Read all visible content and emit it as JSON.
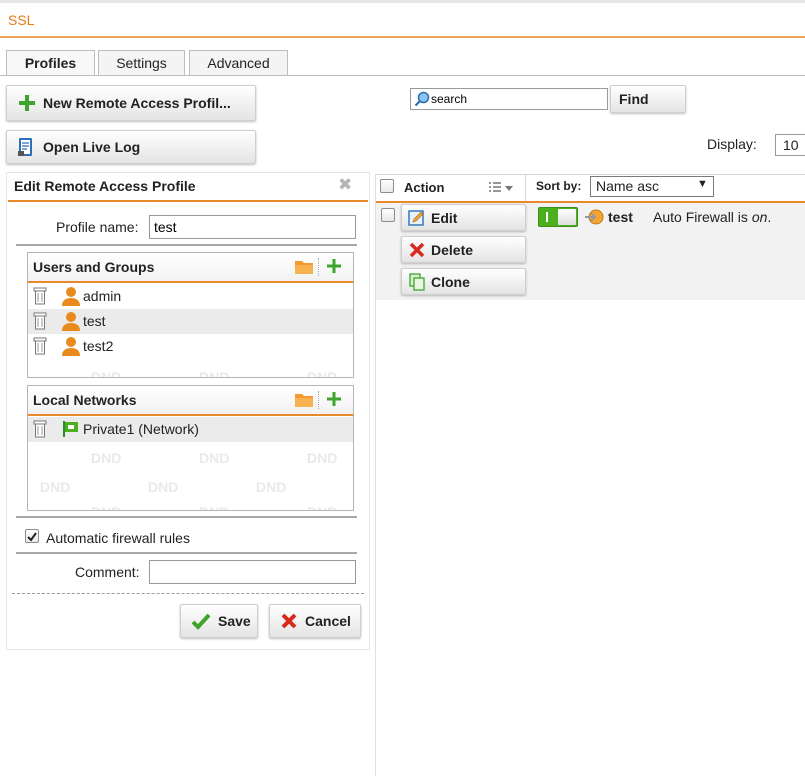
{
  "app": {
    "title": "SSL"
  },
  "tabs": [
    {
      "label": "Profiles",
      "active": true
    },
    {
      "label": "Settings",
      "active": false
    },
    {
      "label": "Advanced",
      "active": false
    }
  ],
  "toolbar": {
    "new_profile_label": "New Remote Access Profil...",
    "open_live_log_label": "Open Live Log",
    "search": {
      "value": "search",
      "placeholder": "search"
    },
    "find_label": "Find",
    "display_label": "Display:",
    "display_value": "10"
  },
  "edit_panel": {
    "title": "Edit Remote Access Profile",
    "close_icon": "close-icon",
    "profile_name_label": "Profile name:",
    "profile_name_value": "test",
    "users_groups": {
      "title": "Users and Groups",
      "items": [
        {
          "label": "admin",
          "icon": "user-icon"
        },
        {
          "label": "test",
          "icon": "user-icon"
        },
        {
          "label": "test2",
          "icon": "user-icon"
        }
      ]
    },
    "local_networks": {
      "title": "Local Networks",
      "items": [
        {
          "label": "Private1 (Network)",
          "icon": "network-icon"
        }
      ]
    },
    "dnd_text": "DND",
    "auto_firewall_label": "Automatic firewall rules",
    "auto_firewall_checked": true,
    "comment_label": "Comment:",
    "comment_value": "",
    "save_label": "Save",
    "cancel_label": "Cancel"
  },
  "grid": {
    "action_header": "Action",
    "sort_by_label": "Sort by:",
    "sort_value": "Name asc",
    "row": {
      "edit_label": "Edit",
      "delete_label": "Delete",
      "clone_label": "Clone",
      "enabled": true,
      "name": "test",
      "status_prefix": "Auto Firewall is ",
      "status_value": "on",
      "status_suffix": "."
    }
  },
  "colors": {
    "accent": "#e88a2a",
    "title_orange": "#e87d14",
    "toggle_green": "#4caf1e",
    "delete_red": "#d62a1e",
    "save_green": "#3da52b"
  }
}
